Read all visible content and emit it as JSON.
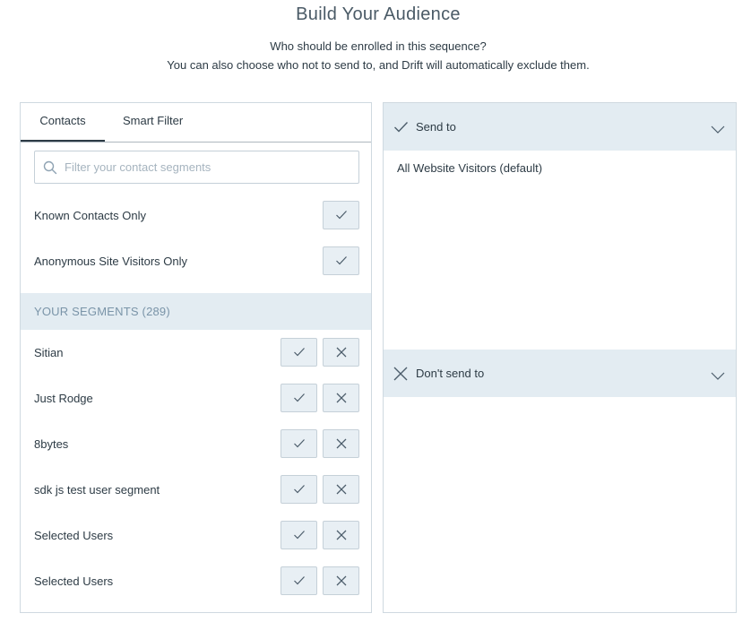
{
  "page": {
    "title": "Build Your Audience",
    "subtitle_line1": "Who should be enrolled in this sequence?",
    "subtitle_line2": "You can also choose who not to send to, and Drift will automatically exclude them."
  },
  "left_panel": {
    "tabs": [
      {
        "label": "Contacts",
        "active": true
      },
      {
        "label": "Smart Filter",
        "active": false
      }
    ],
    "search": {
      "placeholder": "Filter your contact segments",
      "value": ""
    },
    "quick_filters": [
      {
        "label": "Known Contacts Only"
      },
      {
        "label": "Anonymous Site Visitors Only"
      }
    ],
    "segments_header": "YOUR SEGMENTS (289)",
    "segments": [
      {
        "label": "Sitian"
      },
      {
        "label": "Just Rodge"
      },
      {
        "label": "8bytes"
      },
      {
        "label": "sdk js test user segment"
      },
      {
        "label": "Selected Users"
      },
      {
        "label": "Selected Users"
      }
    ]
  },
  "right_panel": {
    "send_to": {
      "label": "Send to",
      "items": [
        "All Website Visitors (default)"
      ]
    },
    "dont_send_to": {
      "label": "Don't send to",
      "items": []
    }
  },
  "icons": {
    "check": "check-icon",
    "close": "close-icon",
    "search": "search-icon",
    "chevron": "chevron-down-icon"
  },
  "colors": {
    "header_bg": "#e3ecf2",
    "button_bg": "#e8eff4",
    "segments_header_text": "#7a94a8",
    "border": "#cfd9e0"
  }
}
